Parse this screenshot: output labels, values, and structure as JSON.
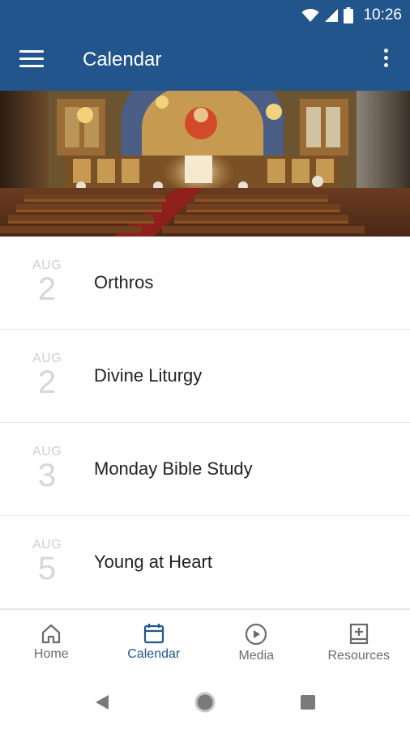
{
  "status_bar": {
    "time": "10:26",
    "icons": [
      "wifi-icon",
      "cell-signal-icon",
      "battery-icon"
    ]
  },
  "app_bar": {
    "title": "Calendar",
    "left_icon": "hamburger-menu-icon",
    "right_icon": "overflow-menu-icon"
  },
  "hero": {
    "image": "church-interior-photo"
  },
  "events": [
    {
      "month": "AUG",
      "day": "2",
      "title": "Orthros"
    },
    {
      "month": "AUG",
      "day": "2",
      "title": "Divine Liturgy"
    },
    {
      "month": "AUG",
      "day": "3",
      "title": "Monday Bible Study"
    },
    {
      "month": "AUG",
      "day": "5",
      "title": "Young at Heart"
    }
  ],
  "bottom_nav": [
    {
      "label": "Home",
      "icon": "home-icon",
      "active": false
    },
    {
      "label": "Calendar",
      "icon": "calendar-icon",
      "active": true
    },
    {
      "label": "Media",
      "icon": "play-circle-icon",
      "active": false
    },
    {
      "label": "Resources",
      "icon": "book-plus-icon",
      "active": false
    }
  ],
  "system_nav": [
    "back-icon",
    "home-circle-icon",
    "recents-icon"
  ],
  "colors": {
    "primary": "#21558c",
    "date_text": "#cfcfcf",
    "title_text": "#222222",
    "nav_inactive": "#6b6b6b"
  }
}
